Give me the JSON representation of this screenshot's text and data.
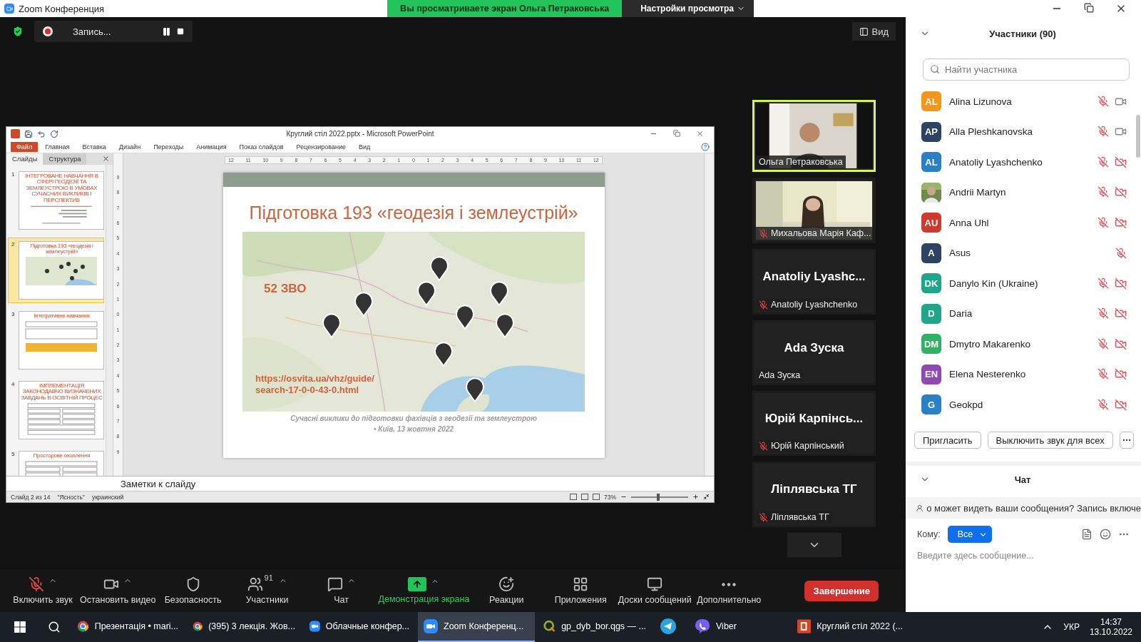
{
  "window": {
    "title": "Zoom Конференция"
  },
  "share_banner": {
    "text": "Вы просматриваете экран Ольга Петраковська",
    "options": "Настройки просмотра"
  },
  "recording": {
    "label": "Запись..."
  },
  "view_button": "Вид",
  "powerpoint": {
    "title": "Круглий стіл 2022.pptx - Microsoft PowerPoint",
    "menu": [
      {
        "label": "Файл",
        "selected": true
      },
      {
        "label": "Главная",
        "selected": false
      },
      {
        "label": "Вставка",
        "selected": false
      },
      {
        "label": "Дизайн",
        "selected": false
      },
      {
        "label": "Переходы",
        "selected": false
      },
      {
        "label": "Анимация",
        "selected": false
      },
      {
        "label": "Показ слайдов",
        "selected": false
      },
      {
        "label": "Рецензирование",
        "selected": false
      },
      {
        "label": "Вид",
        "selected": false
      }
    ],
    "pane_tabs": [
      {
        "label": "Слайды",
        "selected": true
      },
      {
        "label": "Структура",
        "selected": false
      }
    ],
    "thumbnails": [
      {
        "number": "1",
        "title": "ІНТЕГРОВАНЕ НАВЧАННЯ В СФЕРІ ГЕОДЕЗІЇ ТА ЗЕМЛЕУСТРОЮ В УМОВАХ СУЧАСНИХ ВИКЛИКІВ І ПЕРСПЕКТИВ",
        "kind": "title",
        "selected": false
      },
      {
        "number": "2",
        "title": "Підготовка 193 «геодезія і землеустрій»",
        "kind": "map",
        "selected": true
      },
      {
        "number": "3",
        "title": "Інтегративне навчання",
        "kind": "text",
        "selected": false
      },
      {
        "number": "4",
        "title": "ІМПЛЕМЕНТАЦІЯ ЗАКОНОДАВЧО ВИЗНАЧЕНИХ ЗАВДАНЬ В ОСВІТНІЙ ПРОЦЕС",
        "kind": "table",
        "selected": false
      },
      {
        "number": "5",
        "title": "Просторове охоплення",
        "kind": "table",
        "selected": false
      }
    ],
    "hruler": [
      "12",
      "11",
      "10",
      "9",
      "8",
      "7",
      "6",
      "5",
      "4",
      "3",
      "2",
      "1",
      "0",
      "1",
      "2",
      "3",
      "4",
      "5",
      "6",
      "7",
      "8",
      "9",
      "10",
      "11",
      "12"
    ],
    "vruler": [
      "9",
      "8",
      "7",
      "6",
      "5",
      "4",
      "3",
      "2",
      "1",
      "0",
      "1",
      "2",
      "3",
      "4",
      "5",
      "6",
      "7",
      "8",
      "9"
    ],
    "slide": {
      "title": "Підготовка 193 «геодезія і землеустрій»",
      "badge": "52 ЗВО",
      "link_lines": [
        "https://osvita.ua/vhz/guide/",
        "search-17-0-0-43-0.html"
      ],
      "footer": [
        "Сучасні виклики до підготовки фахівців з геодезії та землеустрою",
        "•  Київ, 13 жовтня 2022"
      ]
    },
    "notes": "Заметки к слайду",
    "status": [
      "Слайд 2 из 14",
      "\"Ясность\"",
      "украинский"
    ],
    "zoom": "73%",
    "zoom_slider": {
      "level": 0.45
    }
  },
  "videos": [
    {
      "kind": "video",
      "name": "Ольга Петраковська",
      "muted": false,
      "speaking": true
    },
    {
      "kind": "video",
      "name": "Михальова Марія Каф...",
      "muted": true,
      "speaking": false
    },
    {
      "kind": "avatar",
      "display": "Anatoliy  Lyashc...",
      "name": "Anatoliy Lyashchenko",
      "muted": true,
      "speaking": false
    },
    {
      "kind": "avatar",
      "display": "Ada Зуска",
      "name": "Ada Зуска",
      "muted": false,
      "speaking": false
    },
    {
      "kind": "avatar",
      "display": "Юрій  Карпінсь...",
      "name": "Юрій Карпінський",
      "muted": true,
      "speaking": false
    },
    {
      "kind": "avatar",
      "display": "Ліплявська ТГ",
      "name": "Ліплявська ТГ",
      "muted": true,
      "speaking": false
    }
  ],
  "toolbar": [
    {
      "label": "Включить звук",
      "has_menu": true,
      "highlighted": false
    },
    {
      "label": "Остановить видео",
      "has_menu": true,
      "highlighted": false
    },
    {
      "label": "Безопасность",
      "has_menu": false,
      "highlighted": false
    },
    {
      "label": "Участники",
      "count": "91",
      "has_menu": true,
      "highlighted": false
    },
    {
      "label": "Чат",
      "has_menu": true,
      "highlighted": false
    },
    {
      "label": "Демонстрация экрана",
      "has_menu": true,
      "highlighted": true
    },
    {
      "label": "Реакции",
      "has_menu": false,
      "highlighted": false
    },
    {
      "label": "Приложения",
      "has_menu": false,
      "highlighted": false
    },
    {
      "label": "Доски сообщений",
      "has_menu": false,
      "highlighted": false
    },
    {
      "label": "Дополнительно",
      "has_menu": false,
      "highlighted": false
    }
  ],
  "end_button": "Завершение",
  "participants_panel": {
    "title": "Участники (90)",
    "search": {
      "placeholder": "Найти участника"
    },
    "participants": [
      {
        "kind": "initials",
        "initials": "AL",
        "color": "#f2961c",
        "name": "Alina Lizunova",
        "mic_muted": true,
        "camera_shown": true,
        "video_off": false
      },
      {
        "kind": "initials",
        "initials": "AP",
        "color": "#2e4263",
        "name": "Alla Pleshkanovska",
        "mic_muted": true,
        "camera_shown": true,
        "video_off": false
      },
      {
        "kind": "initials",
        "initials": "AL",
        "color": "#2b7fc4",
        "name": "Anatoliy Lyashchenko",
        "mic_muted": true,
        "camera_shown": true,
        "video_off": true
      },
      {
        "name": "Andrii Martyn",
        "mic_muted": true,
        "camera_shown": true,
        "video_off": true
      },
      {
        "kind": "initials",
        "initials": "AU",
        "color": "#cf3a2d",
        "name": "Anna Uhl",
        "mic_muted": true,
        "camera_shown": true,
        "video_off": true
      },
      {
        "kind": "initials",
        "initials": "A",
        "color": "#2e4263",
        "name": "Asus",
        "mic_muted": true,
        "camera_shown": false
      },
      {
        "kind": "initials",
        "initials": "DK",
        "color": "#1fa58a",
        "name": "Danylo Kin (Ukraine)",
        "mic_muted": true,
        "camera_shown": true,
        "video_off": true
      },
      {
        "kind": "initials",
        "initials": "D",
        "color": "#1fa58a",
        "name": "Daria",
        "mic_muted": true,
        "camera_shown": true,
        "video_off": true
      },
      {
        "kind": "initials",
        "initials": "DM",
        "color": "#2db266",
        "name": "Dmytro Makarenko",
        "mic_muted": true,
        "camera_shown": true,
        "video_off": true
      },
      {
        "kind": "initials",
        "initials": "EN",
        "color": "#8e49b5",
        "name": "Elena Nesterenko",
        "mic_muted": true,
        "camera_shown": true,
        "video_off": true
      },
      {
        "kind": "initials",
        "initials": "G",
        "color": "#2b7fc4",
        "name": "Geokpd",
        "mic_muted": true,
        "camera_shown": true,
        "video_off": true
      }
    ],
    "buttons": [
      "Пригласить",
      "Выключить звук для всех"
    ]
  },
  "chat": {
    "title": "Чат",
    "notice": "о может видеть ваши сообщения? Запись включе",
    "to_label": "Кому:",
    "recipient": "Все",
    "placeholder": "Введите здесь сообщение..."
  },
  "taskbar": {
    "tasks": [
      {
        "label": "Презентація • mari...",
        "selected": false
      },
      {
        "label": "(395) 3 лекція. Жов...",
        "selected": false
      },
      {
        "label": "Облачные конфер...",
        "selected": false
      },
      {
        "label": "Zoom Конференц...",
        "selected": true
      },
      {
        "label": "gp_dyb_bor.qgs — ...",
        "selected": false
      },
      {
        "selected": false
      },
      {
        "label": "Viber",
        "selected": false
      },
      {
        "label": "Круглий стіл 2022 (...",
        "selected": false
      }
    ],
    "language": "УКР",
    "time": "14:37",
    "date": "13.10.2022"
  }
}
